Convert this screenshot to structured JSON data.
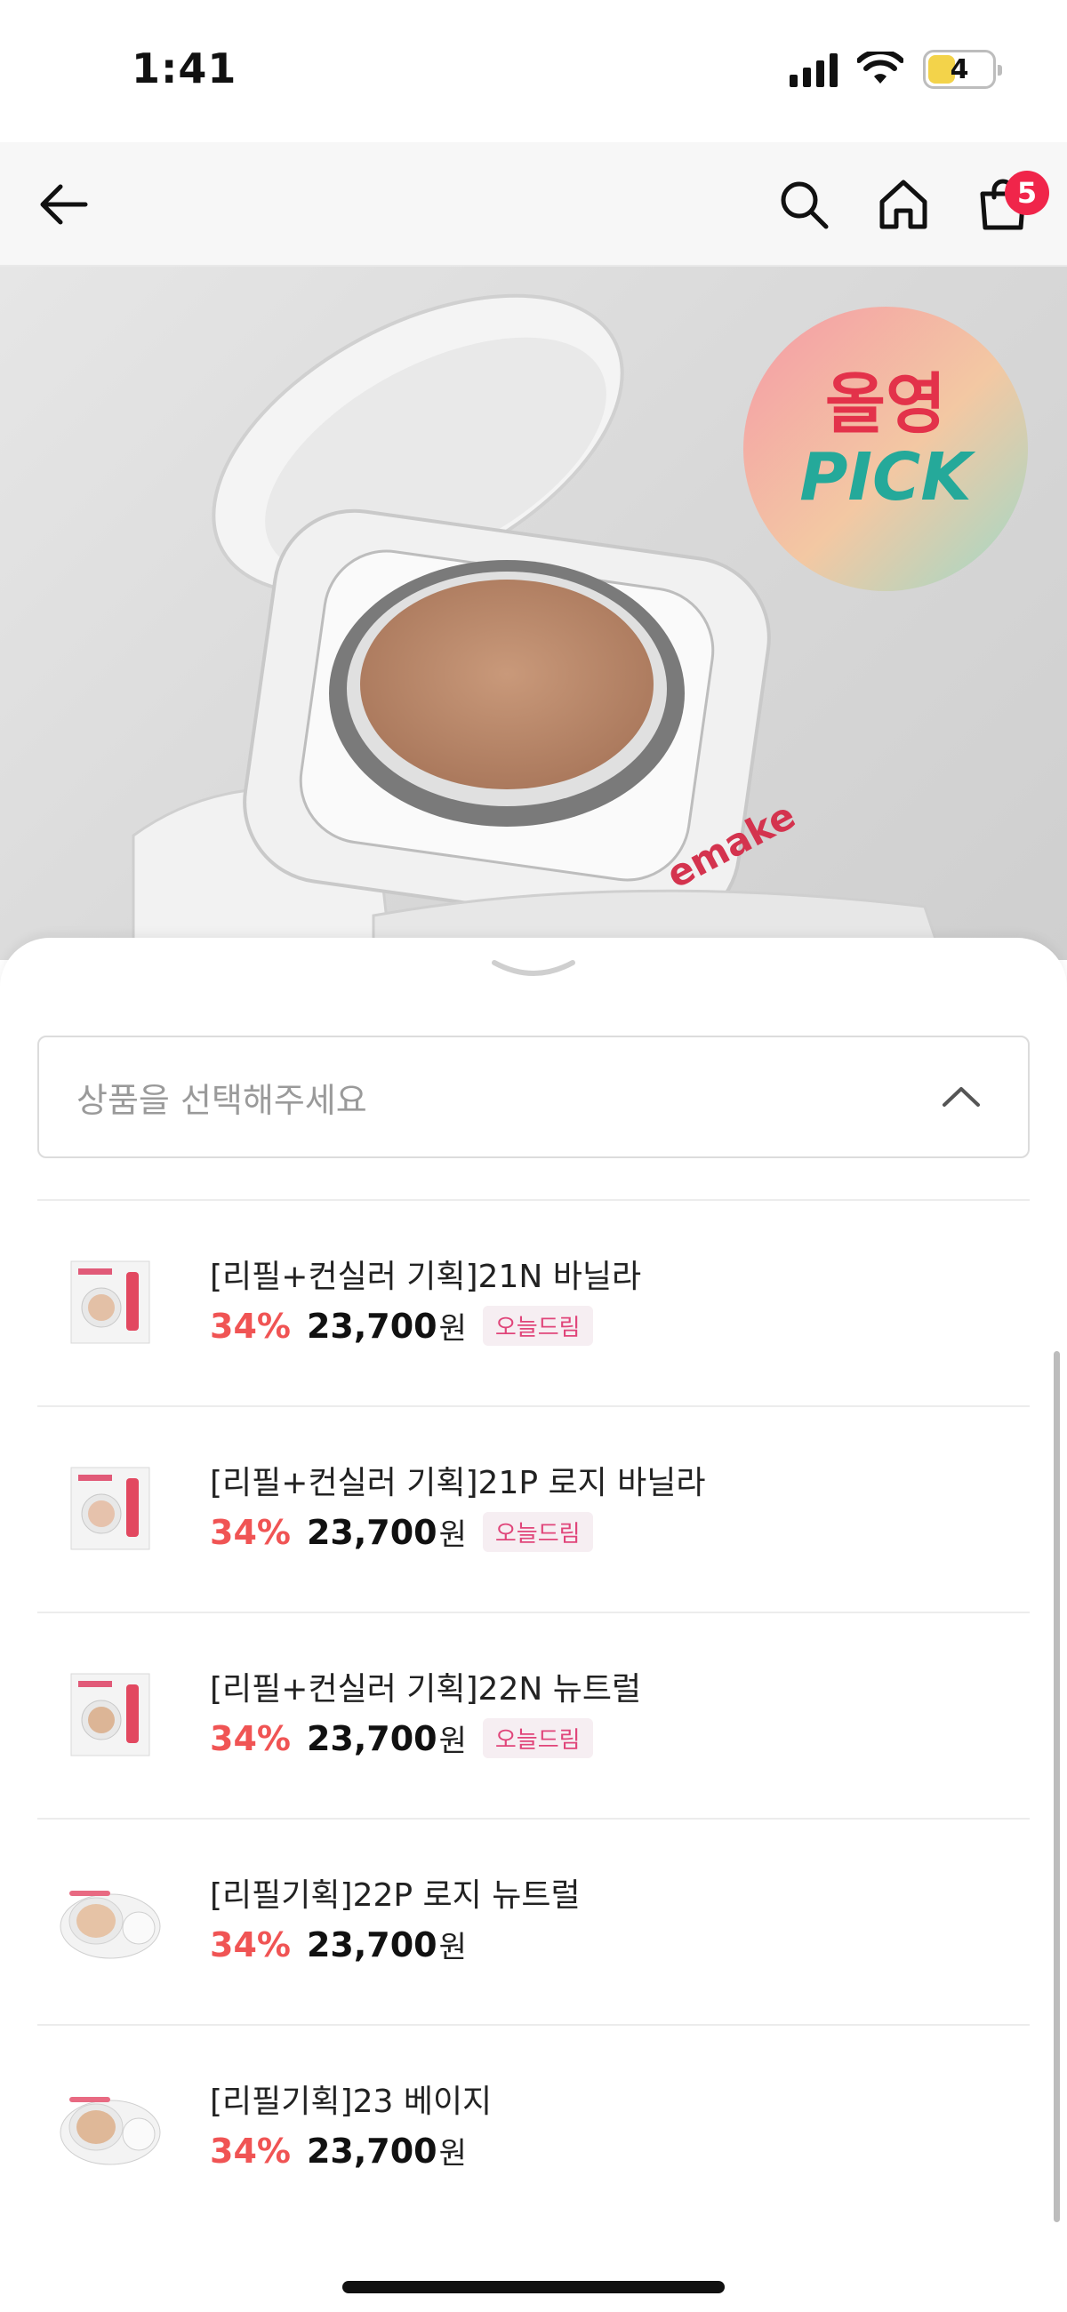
{
  "status_bar": {
    "time": "1:41",
    "battery": "4",
    "icons": [
      "cellular-signal-icon",
      "wifi-icon",
      "battery-icon"
    ]
  },
  "header": {
    "icons": [
      "back-arrow-icon",
      "search-icon",
      "home-icon",
      "shopping-bag-icon"
    ],
    "cart_count": "5"
  },
  "hero": {
    "brand_text": "emake",
    "badge_line1": "올영",
    "badge_line2": "PICK"
  },
  "sheet": {
    "select_placeholder": "상품을 선택해주세요",
    "items": [
      {
        "name": "[리필+컨실러 기획]21N 바닐라",
        "discount": "34%",
        "price": "23,700",
        "currency": "원",
        "tag": "오늘드림"
      },
      {
        "name": "[리필+컨실러 기획]21P 로지 바닐라",
        "discount": "34%",
        "price": "23,700",
        "currency": "원",
        "tag": "오늘드림"
      },
      {
        "name": "[리필+컨실러 기획]22N 뉴트럴",
        "discount": "34%",
        "price": "23,700",
        "currency": "원",
        "tag": "오늘드림"
      },
      {
        "name": "[리필기획]22P 로지 뉴트럴",
        "discount": "34%",
        "price": "23,700",
        "currency": "원"
      },
      {
        "name": "[리필기획]23 베이지",
        "discount": "34%",
        "price": "23,700",
        "currency": "원"
      }
    ]
  },
  "colors": {
    "discount": "#f05454",
    "tag_text": "#e0457a",
    "tag_bg": "#f6eef2",
    "badge": "#f0254a"
  }
}
